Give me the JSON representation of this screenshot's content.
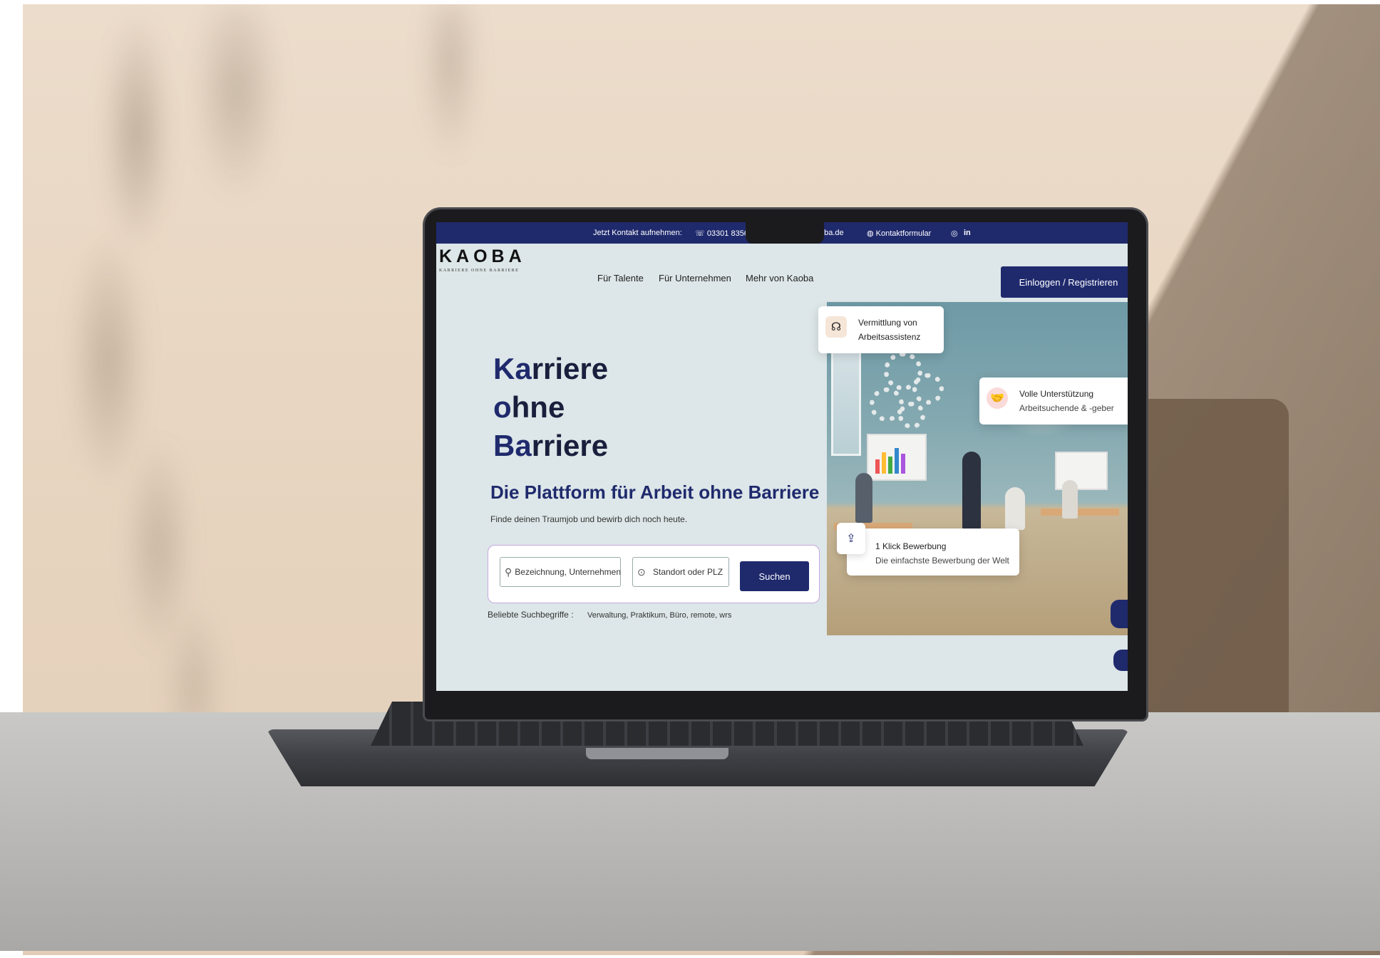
{
  "topbar": {
    "contact_label": "Jetzt Kontakt aufnehmen:",
    "phone": "03301 8356",
    "email_partial": "oba.de",
    "form_label": "Kontaktformular",
    "instagram_icon": "instagram-icon",
    "linkedin": "in"
  },
  "nav": {
    "logo": "KAOBA",
    "logo_tagline": "KARRIERE OHNE BARRIERE",
    "links": [
      "Für Talente",
      "Für Unternehmen",
      "Mehr von Kaoba"
    ],
    "login_label": "Einloggen / Registrieren"
  },
  "hero": {
    "line1_accent": "Ka",
    "line1_rest": "rriere",
    "line2_accent": "o",
    "line2_rest": "hne",
    "line3_accent": "Ba",
    "line3_rest": "rriere",
    "subtitle": "Die Plattform für Arbeit ohne Barriere",
    "description": "Finde deinen Traumjob und bewirb dich noch heute."
  },
  "search": {
    "keyword_placeholder": "Bezeichnung, Unternehmen",
    "location_placeholder": "Standort oder PLZ",
    "button_label": "Suchen",
    "popular_label": "Beliebte Suchbegriffe :",
    "popular_terms": "Verwaltung, Praktikum, Büro, remote, wrs"
  },
  "cards": {
    "assistance": {
      "line1": "Vermittlung von",
      "line2": "Arbeitsassistenz",
      "icon": "headset-icon"
    },
    "support": {
      "line1": "Volle Unterstützung",
      "line2": "Arbeitsuchende & -geber",
      "icon": "handshake-icon"
    },
    "apply": {
      "line1": "1 Klick Bewerbung",
      "line2": "Die einfachste Bewerbung der Welt",
      "icon": "upload-file-icon"
    }
  },
  "colors": {
    "brand": "#1f2a6d",
    "screen_bg": "#dde6e8",
    "search_border": "#c6a9e0"
  }
}
